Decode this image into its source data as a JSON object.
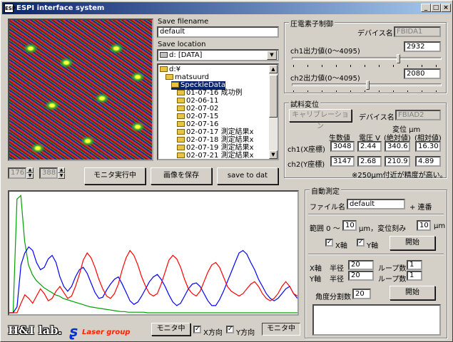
{
  "window": {
    "title": "ESPI interface system",
    "icon_label": "ESP",
    "minimize": "_",
    "maximize": "□",
    "close": "×"
  },
  "save": {
    "filename_label": "Save filename",
    "filename_value": "default",
    "location_label": "Save location",
    "drive_value": "d: [DATA]",
    "folders": [
      {
        "label": "d:¥",
        "indent": 0,
        "selected": false
      },
      {
        "label": "matsuurd",
        "indent": 1,
        "selected": false
      },
      {
        "label": "SpeckleData",
        "indent": 2,
        "selected": true
      },
      {
        "label": "01-07-16 成功例",
        "indent": 3,
        "selected": false
      },
      {
        "label": "02-06-11",
        "indent": 3,
        "selected": false
      },
      {
        "label": "02-07-02",
        "indent": 3,
        "selected": false
      },
      {
        "label": "02-07-15",
        "indent": 3,
        "selected": false
      },
      {
        "label": "02-07-16",
        "indent": 3,
        "selected": false
      },
      {
        "label": "02-07-17 測定結果x",
        "indent": 3,
        "selected": false
      },
      {
        "label": "02-07-18 測定結果x",
        "indent": 3,
        "selected": false
      },
      {
        "label": "02-07-19 測定結果x",
        "indent": 3,
        "selected": false
      },
      {
        "label": "02-07-21 測定結果x",
        "indent": 3,
        "selected": false
      }
    ]
  },
  "image_coords": {
    "x": "176",
    "y": "388"
  },
  "buttons": {
    "monitor_run": "モニタ実行中",
    "save_image": "画像を保存",
    "save_dat": "save to dat"
  },
  "piezo": {
    "title": "圧電素子制御",
    "device_label": "デバイス名",
    "device_value": "FBIDA1",
    "ch1_label": "ch1出力値(0～4095)",
    "ch1_value": "2932",
    "ch1_level": 0.716,
    "ch2_label": "ch2出力値(0～4095)",
    "ch2_value": "2080",
    "ch2_level": 0.508
  },
  "sample": {
    "title": "試料変位",
    "calibrate": "キャリブレーション",
    "device_label": "デバイス名",
    "device_value": "FBIAD2",
    "unit_header": "変位 μm",
    "col_raw": "生数値",
    "col_volt": "電圧 V",
    "col_abs": "(絶対値)",
    "col_rel": "(相対値)",
    "rows": [
      {
        "label": "ch1(X座標)",
        "raw": "3048",
        "volt": "2.44",
        "abs": "340.6",
        "rel": "16.30"
      },
      {
        "label": "ch2(Y座標)",
        "raw": "3147",
        "volt": "2.68",
        "abs": "210.9",
        "rel": "4.89"
      }
    ],
    "note": "※250μm付近が精度が高い。"
  },
  "auto": {
    "title": "自動測定",
    "file_label": "ファイル名",
    "file_value": "default",
    "file_suffix": "+ 連番",
    "range_label": "範囲 0 ～",
    "range_value": "10",
    "range_unit": "μm，変位刻み",
    "step_value": "10",
    "step_unit": "μm",
    "x_axis": "X軸",
    "y_axis": "Y軸",
    "start1": "開始",
    "xaxis2": "X軸",
    "yaxis2": "Y軸",
    "radius": "半径",
    "x_radius": "20",
    "y_radius": "20",
    "loops": "ループ数",
    "x_loops": "1",
    "y_loops": "1",
    "angle_label": "角度分割数",
    "angle_value": "20",
    "start2": "開始"
  },
  "bottom": {
    "logo": "H&I lab.",
    "laser": "Laser group",
    "monitor_btn": "モニタ中",
    "x_dir": "X方向",
    "y_dir": "Y方向",
    "monitor_btn2": "モニタ中"
  },
  "colors": {
    "green": "#00a000",
    "blue": "#0000ff",
    "red": "#ff0000",
    "accent": "#0a246a"
  },
  "chart_data": {
    "type": "line",
    "title": "",
    "xlabel": "",
    "ylabel": "",
    "xlim": [
      0,
      100
    ],
    "ylim": [
      0,
      100
    ],
    "grid": false,
    "series": [
      {
        "color": "#00a000",
        "values": [
          0,
          0,
          95,
          98,
          60,
          40,
          32,
          27,
          24,
          21,
          19,
          17,
          15,
          14,
          12,
          11,
          10,
          9,
          8,
          7,
          6,
          5,
          4.5,
          4,
          3.5,
          3,
          2.5,
          2,
          1.5,
          1,
          1,
          0.5,
          0.5,
          0.5,
          0.5,
          0.5,
          0,
          0,
          0,
          0,
          0,
          0,
          0,
          0,
          0,
          0,
          0,
          0,
          0,
          0,
          0,
          0,
          0,
          0,
          0,
          0,
          0,
          0,
          0,
          0,
          0,
          0,
          0,
          0,
          0,
          0,
          0,
          0,
          0,
          0,
          0,
          0,
          0,
          0,
          0,
          0
        ]
      },
      {
        "color": "#0000ff",
        "values": [
          0,
          0,
          5,
          40,
          50,
          55,
          52,
          42,
          36,
          38,
          45,
          48,
          42,
          30,
          22,
          18,
          22,
          30,
          36,
          38,
          33,
          25,
          17,
          12,
          13,
          19,
          24,
          28,
          30,
          24,
          17,
          10,
          7,
          9,
          14,
          20,
          26,
          30,
          32,
          28,
          22,
          15,
          9,
          6,
          8,
          14,
          20,
          24,
          25,
          22,
          16,
          10,
          6,
          6,
          11,
          18,
          26,
          34,
          42,
          50,
          52,
          49,
          42,
          36,
          28,
          22,
          16,
          12,
          10,
          12,
          16,
          20,
          22,
          16,
          12
        ]
      },
      {
        "color": "#ff0000",
        "values": [
          0,
          0,
          0,
          8,
          15,
          12,
          8,
          14,
          20,
          16,
          10,
          12,
          18,
          22,
          17,
          12,
          14,
          22,
          32,
          44,
          50,
          46,
          38,
          28,
          20,
          14,
          12,
          16,
          24,
          36,
          46,
          52,
          48,
          40,
          30,
          22,
          16,
          14,
          16,
          24,
          34,
          44,
          48,
          45,
          38,
          28,
          20,
          16,
          14,
          18,
          26,
          34,
          40,
          42,
          38,
          30,
          22,
          18,
          16,
          14,
          16,
          20,
          24,
          26,
          22,
          16,
          12,
          10,
          12,
          16,
          22,
          26,
          22,
          16,
          14
        ]
      }
    ]
  }
}
